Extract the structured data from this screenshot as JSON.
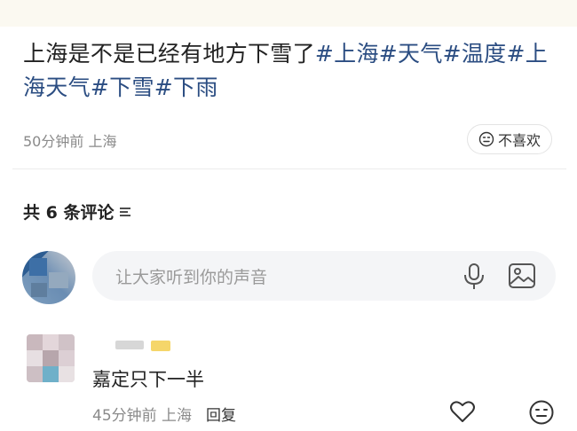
{
  "post": {
    "text_plain": "上海是不是已经有地方下雪了",
    "tags": [
      "#上海",
      "#天气",
      "#温度",
      "#上海天气",
      "#下雪",
      "#下雨"
    ],
    "time": "50分钟前",
    "location": "上海",
    "dislike_label": "不喜欢"
  },
  "comments_section": {
    "count_label": "共 6 条评论",
    "input_placeholder": "让大家听到你的声音"
  },
  "comments": [
    {
      "text": "嘉定只下一半",
      "time": "45分钟前",
      "location": "上海",
      "reply_label": "回复"
    }
  ],
  "icons": {
    "dislike": "meh-face-icon",
    "sort": "sort-lines-icon",
    "mic": "microphone-icon",
    "image": "image-icon",
    "like": "heart-icon",
    "comment_dislike": "meh-face-icon"
  },
  "colors": {
    "tag": "#2b4d82",
    "meta": "#8a8a8a",
    "input_bg": "#f4f5f7"
  }
}
